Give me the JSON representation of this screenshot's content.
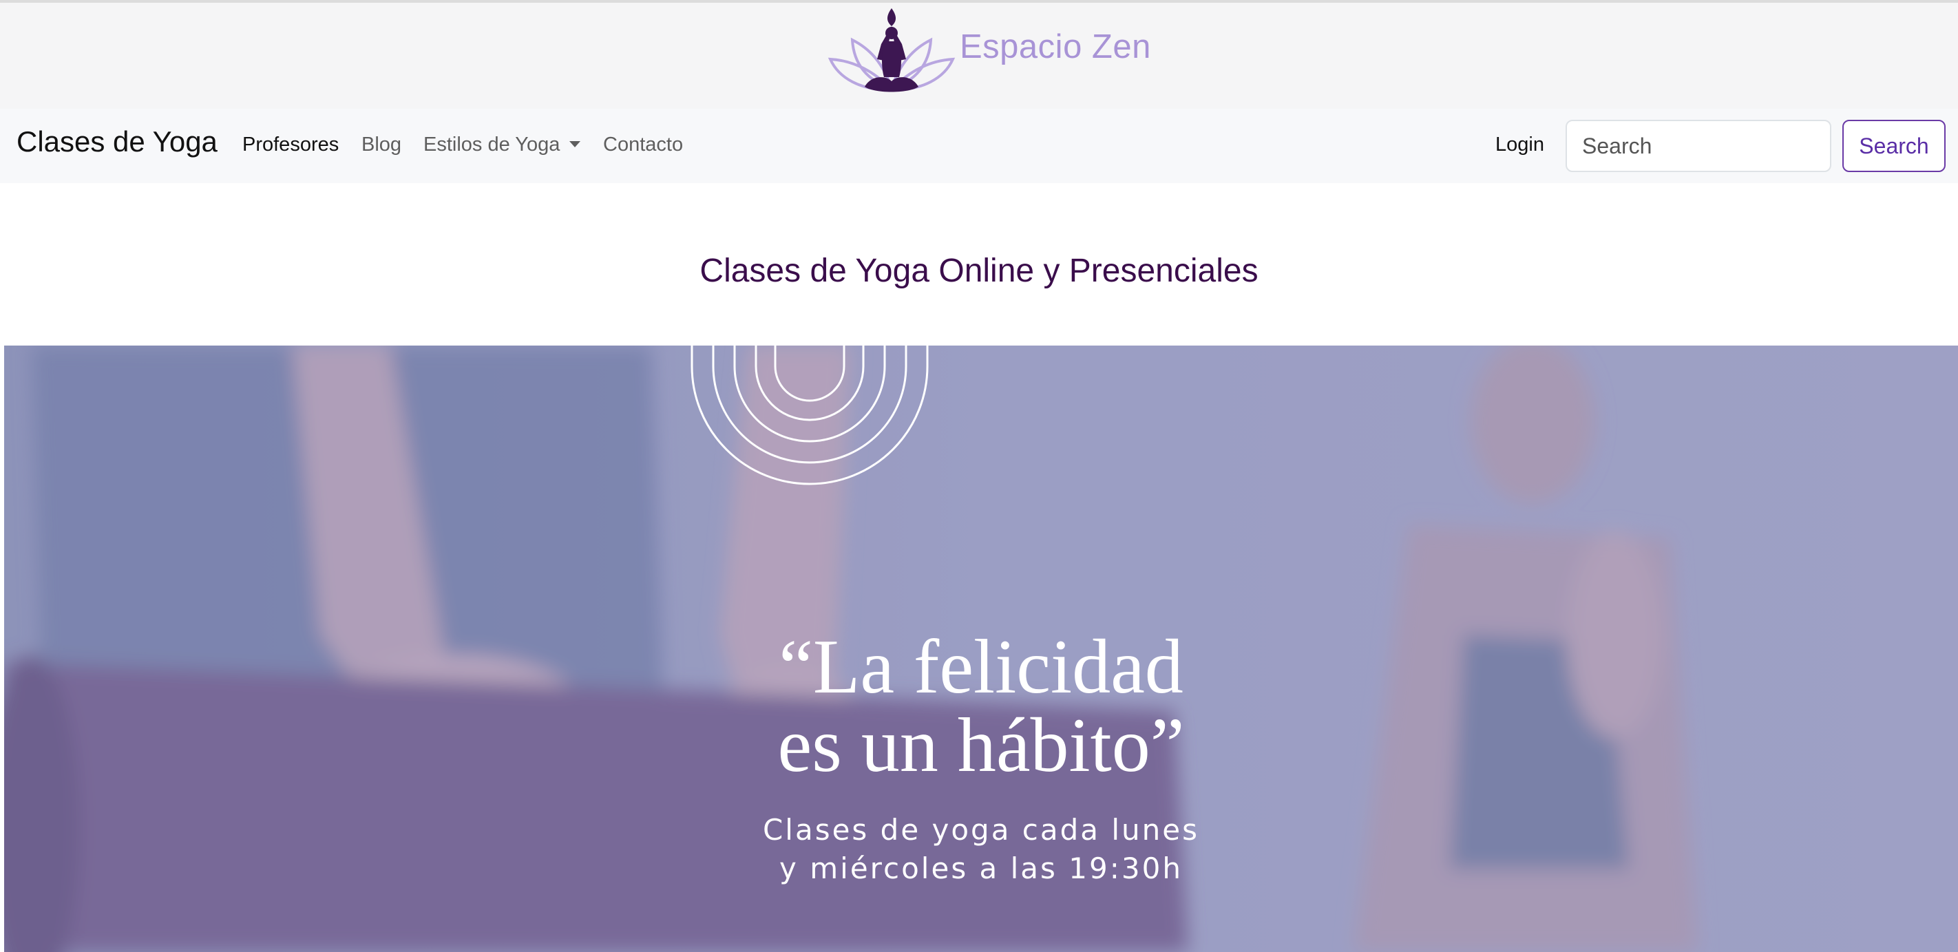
{
  "brand": {
    "name": "Espacio Zen",
    "logo_icon": "lotus-meditation-icon"
  },
  "navbar": {
    "brand": "Clases de Yoga",
    "links": [
      {
        "label": "Profesores",
        "active": true
      },
      {
        "label": "Blog",
        "active": false
      },
      {
        "label": "Estilos de Yoga",
        "active": false,
        "dropdown": true
      },
      {
        "label": "Contacto",
        "active": false
      }
    ],
    "login": "Login",
    "search_placeholder": "Search",
    "search_button": "Search"
  },
  "main": {
    "title": "Clases de Yoga Online y Presenciales"
  },
  "hero": {
    "quote_line1": "“La felicidad",
    "quote_line2": "es un hábito”",
    "subtitle_line1": "Clases de yoga cada lunes",
    "subtitle_line2": "y miércoles a las 19:30h",
    "decoration_icon": "concentric-arches-icon"
  },
  "colors": {
    "brand_purple": "#a893d6",
    "title_purple": "#3a0d4b",
    "button_purple": "#5a2ea6",
    "hero_overlay": "#9da1c2"
  }
}
